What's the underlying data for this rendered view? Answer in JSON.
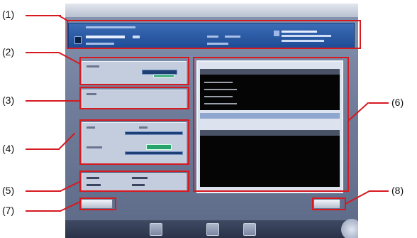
{
  "callouts": [
    {
      "id": "c1",
      "text": "(1)"
    },
    {
      "id": "c2",
      "text": "(2)"
    },
    {
      "id": "c3",
      "text": "(3)"
    },
    {
      "id": "c4",
      "text": "(4)"
    },
    {
      "id": "c5",
      "text": "(5)"
    },
    {
      "id": "c6",
      "text": "(6)"
    },
    {
      "id": "c7",
      "text": "(7)"
    },
    {
      "id": "c8",
      "text": "(8)"
    }
  ],
  "colors": {
    "callout_red": "#d71920",
    "header_blue": "#1f4c96",
    "status_green": "#28a36b",
    "panel_gray": "#c4cddd",
    "table_black": "#050505"
  },
  "icons": {
    "header_icon": "patient-card-icon",
    "corner_button": "round-gear-icon"
  }
}
